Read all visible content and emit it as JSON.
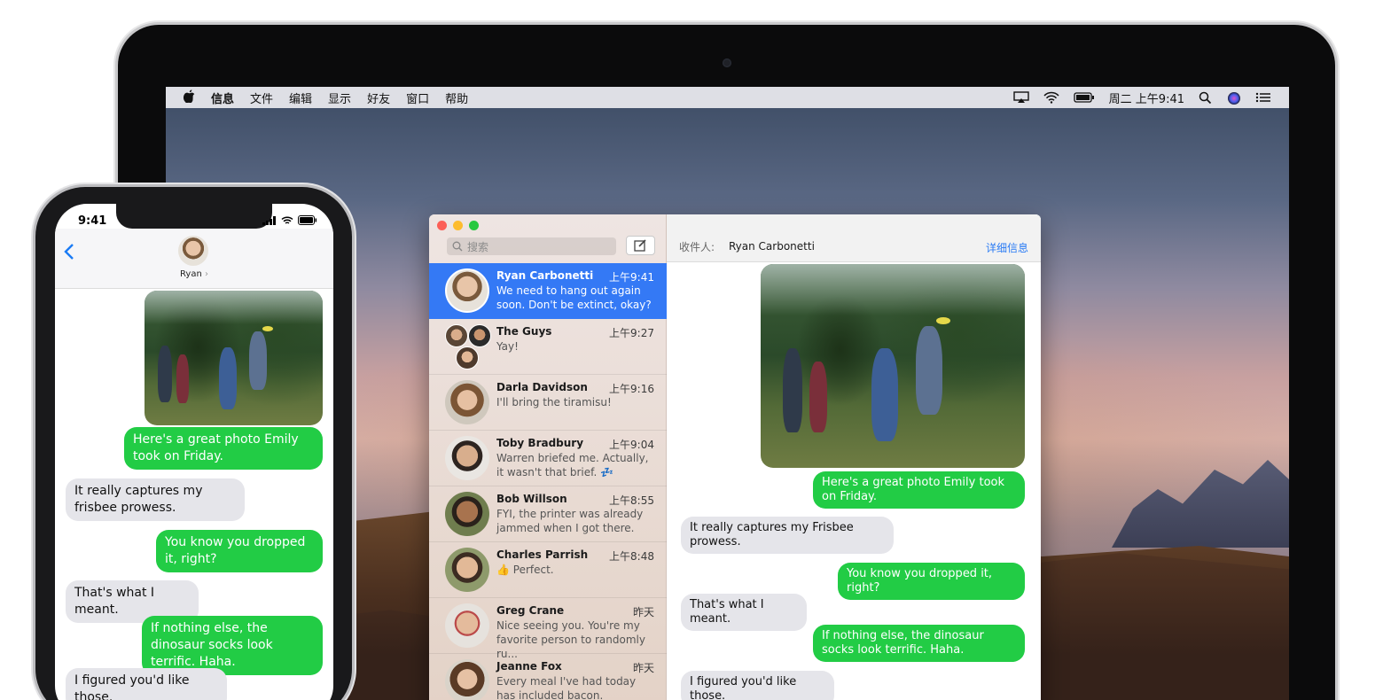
{
  "menubar": {
    "app_name": "信息",
    "menus": [
      "文件",
      "编辑",
      "显示",
      "好友",
      "窗口",
      "帮助"
    ],
    "clock": "周二 上午9:41",
    "status_icons": [
      "airplay-icon",
      "wifi-icon",
      "battery-icon",
      "search-icon",
      "siri-icon",
      "notification-center-icon"
    ]
  },
  "messages_window": {
    "search_placeholder": "搜索",
    "conversations": [
      {
        "name": "Ryan Carbonetti",
        "time": "上午9:41",
        "preview": "We need to hang out again soon. Don't be extinct, okay?",
        "selected": true
      },
      {
        "name": "The Guys",
        "time": "上午9:27",
        "preview": "Yay!"
      },
      {
        "name": "Darla Davidson",
        "time": "上午9:16",
        "preview": "I'll bring the tiramisu!"
      },
      {
        "name": "Toby Bradbury",
        "time": "上午9:04",
        "preview": "Warren briefed me. Actually, it wasn't that brief. 💤"
      },
      {
        "name": "Bob Willson",
        "time": "上午8:55",
        "preview": "FYI, the printer was already jammed when I got there."
      },
      {
        "name": "Charles Parrish",
        "time": "上午8:48",
        "preview": "👍 Perfect."
      },
      {
        "name": "Greg Crane",
        "time": "昨天",
        "preview": "Nice seeing you. You're my favorite person to randomly ru..."
      },
      {
        "name": "Jeanne Fox",
        "time": "昨天",
        "preview": "Every meal I've had today has included bacon. #winning"
      }
    ],
    "chat": {
      "to_label": "收件人:",
      "to_name": "Ryan Carbonetti",
      "details_label": "详细信息",
      "messages": [
        {
          "dir": "sent",
          "text": "Here's a great photo Emily took on Friday."
        },
        {
          "dir": "recv",
          "text": "It really captures my Frisbee prowess."
        },
        {
          "dir": "sent",
          "text": "You know you dropped it, right?"
        },
        {
          "dir": "recv",
          "text": "That's what I meant."
        },
        {
          "dir": "sent",
          "text": "If nothing else, the dinosaur socks look terrific. Haha."
        },
        {
          "dir": "recv",
          "text": "I figured you'd like those."
        }
      ]
    }
  },
  "iphone": {
    "time": "9:41",
    "contact_name": "Ryan",
    "messages": [
      {
        "dir": "sent",
        "text": "Here's a great photo Emily took on Friday."
      },
      {
        "dir": "recv",
        "text": "It really captures my frisbee prowess."
      },
      {
        "dir": "sent",
        "text": "You know you dropped it, right?"
      },
      {
        "dir": "recv",
        "text": "That's what I meant."
      },
      {
        "dir": "sent",
        "text": "If nothing else, the dinosaur socks look terrific. Haha."
      },
      {
        "dir": "recv",
        "text": "I figured you'd like those."
      }
    ]
  },
  "colors": {
    "sent_bubble": "#22cc45",
    "recv_bubble": "#e5e5ea",
    "selection": "#3479f5",
    "link": "#2a7bf4"
  }
}
